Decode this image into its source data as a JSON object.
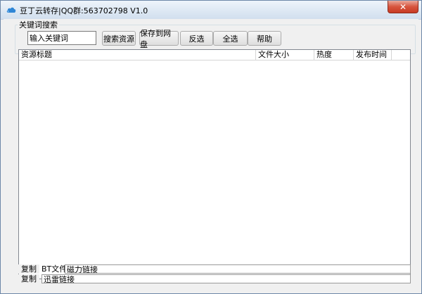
{
  "window": {
    "title": "豆丁云转存|QQ群:563702798  V1.0",
    "close_label": "✕"
  },
  "search": {
    "group_label": "关键词搜索",
    "input_value": "输入关键词",
    "buttons": {
      "search": "搜索资源",
      "save": "保存到网盘",
      "invert": "反选",
      "select_all": "全选",
      "help": "帮助"
    }
  },
  "results": {
    "columns": [
      "资源标题",
      "文件大小",
      "热度",
      "发布时间"
    ],
    "rows": []
  },
  "bottom": {
    "row1": {
      "copy": "复制",
      "label": "BT文件",
      "value": "磁力链接"
    },
    "row2": {
      "copy": "复制",
      "value": "迅雷链接"
    }
  },
  "colors": {
    "titlebar": "#dce7f3",
    "window_bg": "#f0f0f0",
    "close_red": "#c73a23",
    "cloud_icon": "#2f86d6"
  },
  "icons": {
    "app": "cloud-icon",
    "close": "close-icon"
  }
}
